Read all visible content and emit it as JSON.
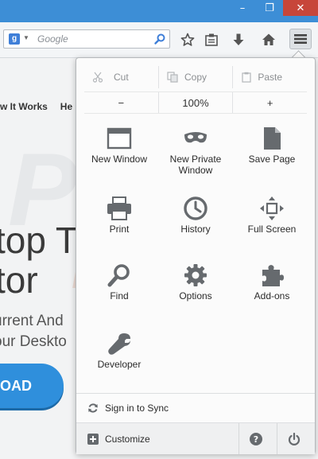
{
  "window": {
    "minimize_glyph": "–",
    "maximize_glyph": "❐",
    "close_glyph": "✕"
  },
  "toolbar": {
    "search_engine_glyph": "g",
    "search_placeholder": "Google",
    "icons": [
      "star-icon",
      "reading-list-icon",
      "download-icon",
      "home-icon",
      "hamburger-menu-icon"
    ]
  },
  "page": {
    "nav": [
      "w It Works",
      "He"
    ],
    "headline_line1": "top T",
    "headline_line2": "tor",
    "sub_line1": "urrent And",
    "sub_line2": "our Deskto",
    "download_label": "LOAD"
  },
  "menu": {
    "edit": {
      "cut": "Cut",
      "copy": "Copy",
      "paste": "Paste"
    },
    "zoom": {
      "out": "−",
      "level": "100%",
      "in": "+"
    },
    "items": [
      {
        "label": "New Window",
        "icon": "new-window-icon"
      },
      {
        "label": "New Private Window",
        "icon": "private-mask-icon"
      },
      {
        "label": "Save Page",
        "icon": "save-page-icon"
      },
      {
        "label": "Print",
        "icon": "print-icon"
      },
      {
        "label": "History",
        "icon": "history-clock-icon"
      },
      {
        "label": "Full Screen",
        "icon": "fullscreen-icon"
      },
      {
        "label": "Find",
        "icon": "find-magnifier-icon"
      },
      {
        "label": "Options",
        "icon": "options-gear-icon"
      },
      {
        "label": "Add-ons",
        "icon": "addons-puzzle-icon"
      },
      {
        "label": "Developer",
        "icon": "developer-wrench-icon"
      }
    ],
    "sync_label": "Sign in to Sync",
    "customize_label": "Customize",
    "help_glyph": "?"
  },
  "colors": {
    "titlebar": "#3d8ed6",
    "close_button": "#c7463a",
    "icon_gray": "#666a6e",
    "accent_blue": "#2f8fdc"
  }
}
